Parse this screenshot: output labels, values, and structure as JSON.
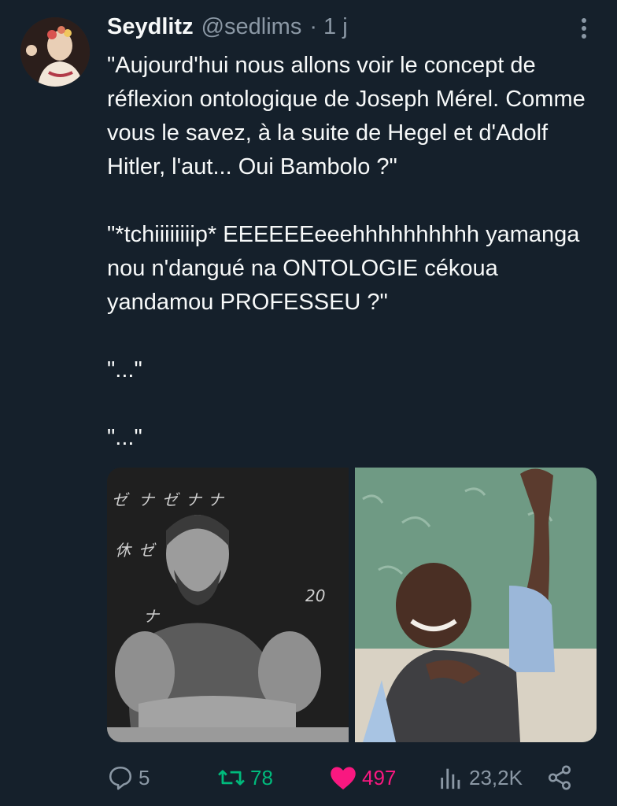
{
  "tweet": {
    "author_name": "Seydlitz",
    "author_handle": "@sedlims",
    "time": "· 1 j",
    "paragraphs": [
      "\"Aujourd'hui nous allons voir le concept de réflexion ontologique de Joseph Mérel. Comme vous le savez, à la suite de Hegel et d'Adolf Hitler, l'aut... Oui Bambolo ?\"",
      "\"*tchiiiiiiiip* EEEEEEeeehhhhhhhhhh yamanga nou n'dangué na ONTOLOGIE cékoua yandamou PROFESSEU ?\"",
      "\"...\"",
      "\"...\""
    ]
  },
  "media": {
    "left_photo": "teacher-photo",
    "right_photo": "student-photo",
    "chalk_marks": [
      "ゼ",
      "ナ",
      "ゼ",
      "ナ",
      "ナ",
      "休",
      "ゼ",
      "20",
      "ナ"
    ]
  },
  "actions": {
    "replies": "5",
    "retweets": "78",
    "likes": "497",
    "views": "23,2K",
    "icons": {
      "reply": "reply-icon",
      "retweet": "retweet-icon",
      "like": "heart-icon",
      "views": "views-chart-icon",
      "share": "share-icon",
      "more": "more-vertical-icon"
    },
    "colors": {
      "retweet": "#00ba7c",
      "like": "#f91880",
      "muted": "#8b98a5"
    }
  }
}
